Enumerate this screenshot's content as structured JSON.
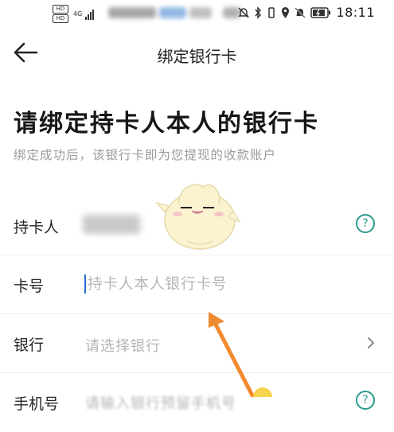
{
  "status_bar": {
    "sim1": "HD",
    "sim2": "HD",
    "network": "4G",
    "time": "18:11"
  },
  "nav": {
    "title": "绑定银行卡"
  },
  "heading": "请绑定持卡人本人的银行卡",
  "subheading": "绑定成功后，该银行卡即为您提现的收款账户",
  "form": {
    "cardholder_label": "持卡人",
    "card_number_label": "卡号",
    "card_number_placeholder": "持卡人本人银行卡号",
    "bank_label": "银行",
    "bank_placeholder": "请选择银行",
    "phone_label": "手机号",
    "phone_placeholder": "请输入银行预留手机号"
  },
  "colors": {
    "accent": "#2a9b8e",
    "caret": "#2c6fd9",
    "arrow": "#f08a30"
  },
  "icons": [
    "back-arrow-icon",
    "help-icon",
    "chevron-right-icon",
    "mascot-sticker"
  ]
}
